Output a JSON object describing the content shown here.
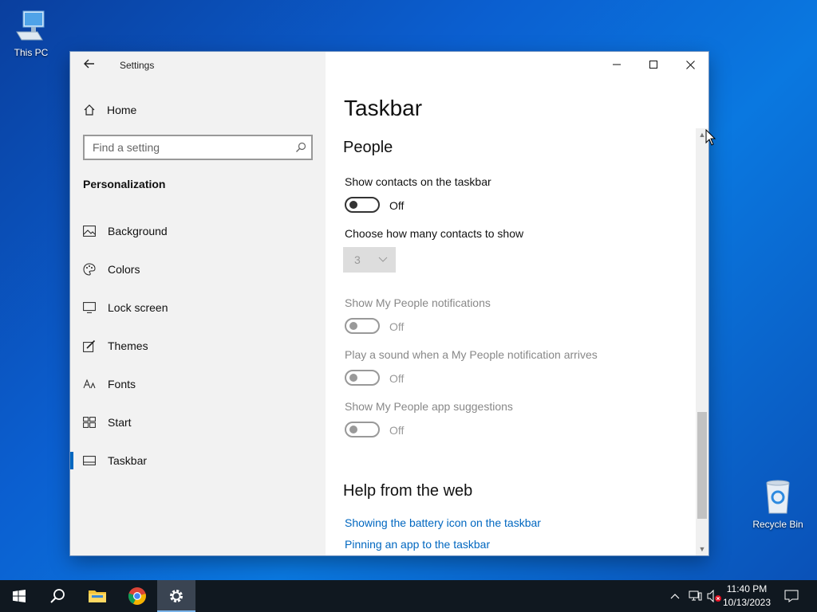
{
  "desktop": {
    "icons": [
      {
        "label": "This PC",
        "icon": "computer-icon"
      },
      {
        "label": "Recycle Bin",
        "icon": "recycle-bin-icon"
      }
    ]
  },
  "window": {
    "app_title": "Settings",
    "controls": [
      "minimize-icon",
      "maximize-icon",
      "close-icon"
    ]
  },
  "sidebar": {
    "home_label": "Home",
    "search_placeholder": "Find a setting",
    "section_title": "Personalization",
    "items": [
      {
        "label": "Background",
        "icon": "picture-icon",
        "active": false
      },
      {
        "label": "Colors",
        "icon": "palette-icon",
        "active": false
      },
      {
        "label": "Lock screen",
        "icon": "lock-screen-icon",
        "active": false
      },
      {
        "label": "Themes",
        "icon": "brush-icon",
        "active": false
      },
      {
        "label": "Fonts",
        "icon": "font-icon",
        "active": false
      },
      {
        "label": "Start",
        "icon": "start-tiles-icon",
        "active": false
      },
      {
        "label": "Taskbar",
        "icon": "taskbar-icon",
        "active": true
      }
    ]
  },
  "content": {
    "page_title": "Taskbar",
    "people": {
      "heading": "People",
      "show_contacts_label": "Show contacts on the taskbar",
      "show_contacts_state": "Off",
      "contacts_count_label": "Choose how many contacts to show",
      "contacts_count_value": "3",
      "notifications_label": "Show My People notifications",
      "notifications_state": "Off",
      "sound_label": "Play a sound when a My People notification arrives",
      "sound_state": "Off",
      "suggestions_label": "Show My People app suggestions",
      "suggestions_state": "Off"
    },
    "help": {
      "heading": "Help from the web",
      "links": [
        "Showing the battery icon on the taskbar",
        "Pinning an app to the taskbar"
      ]
    }
  },
  "taskbar": {
    "apps": [
      "windows-start-icon",
      "search-icon",
      "file-explorer-icon",
      "chrome-icon",
      "settings-gear-icon"
    ],
    "clock_time": "11:40 PM",
    "clock_date": "10/13/2023",
    "tray_icons": [
      "chevron-up-icon",
      "network-icon",
      "speaker-muted-icon",
      "notifications-icon"
    ]
  },
  "colors": {
    "accent": "#0067c0",
    "taskbar": "#101820",
    "sidebar_bg": "#f2f2f2"
  }
}
